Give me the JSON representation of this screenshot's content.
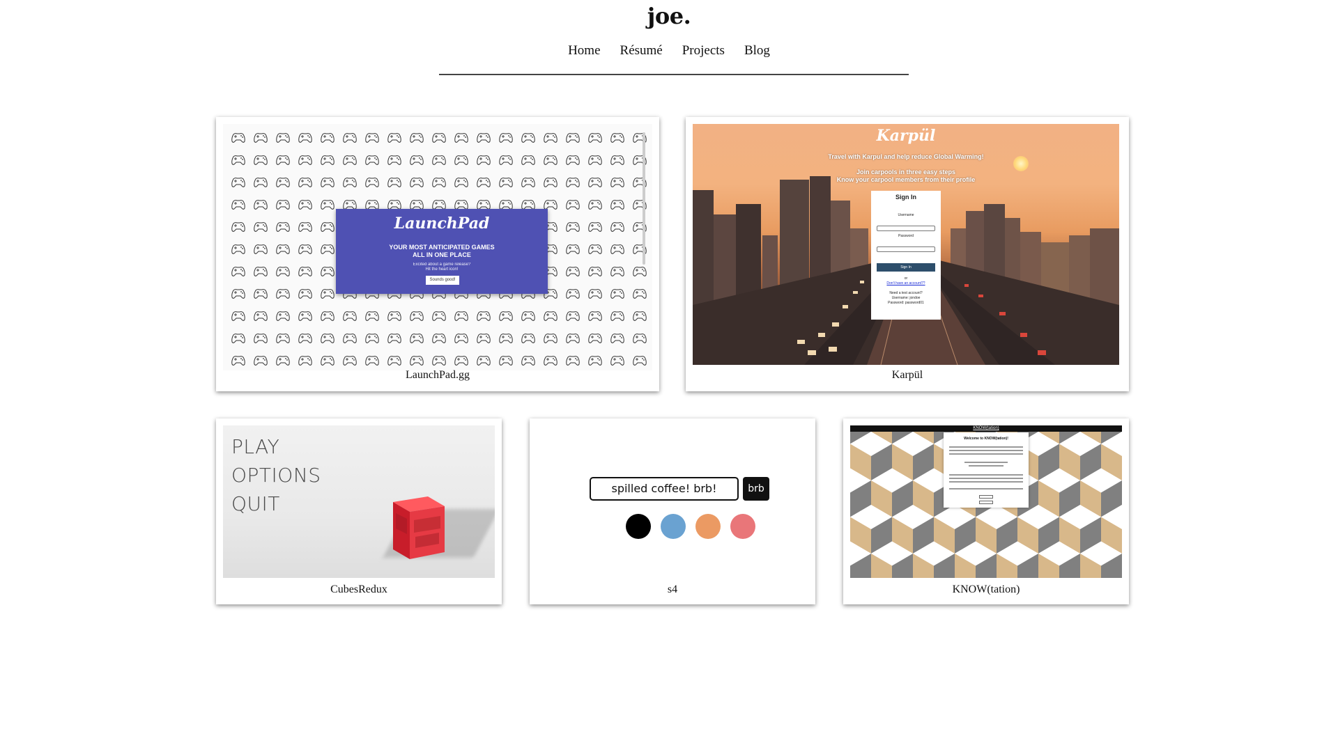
{
  "site": {
    "title": "joe."
  },
  "nav": {
    "items": [
      "Home",
      "Résumé",
      "Projects",
      "Blog"
    ]
  },
  "projects": [
    {
      "caption": "LaunchPad.gg",
      "screenshot": {
        "logo": "LaunchPad",
        "tagline_1": "YOUR MOST ANTICIPATED GAMES",
        "tagline_2": "ALL IN ONE PLACE",
        "sub_1": "Excited about a game release?",
        "sub_2": "Hit the heart icon!",
        "button": "Sounds good!",
        "accent": "#4f51b3",
        "pattern_icon": "gamepad-icon"
      }
    },
    {
      "caption": "Karpül",
      "screenshot": {
        "logo": "Karpül",
        "line_1": "Travel with Karpul and help reduce Global Warming!",
        "line_2": "Join carpools in three easy steps",
        "line_3": "Know your carpool members from their profile",
        "form_title": "Sign In",
        "username_label": "Username",
        "password_label": "Password",
        "signin_button": "Sign In",
        "or": "or",
        "signup_link": "Don't have an account??",
        "test_1": "Need a test account?",
        "test_2": "Username: jondoe",
        "test_3": "Password: password01",
        "button_color": "#2d4e6b"
      }
    },
    {
      "caption": "CubesRedux",
      "screenshot": {
        "menu": [
          "PLAY",
          "OPTIONS",
          "QUIT"
        ],
        "cube_color": "#e8353d"
      }
    },
    {
      "caption": "s4",
      "screenshot": {
        "input_value": "spilled coffee! brb!",
        "button": "brb",
        "swatches": [
          "#000000",
          "#6aa2d1",
          "#eb9a63",
          "#e97679"
        ]
      }
    },
    {
      "caption": "KNOW(tation)",
      "screenshot": {
        "header": "KNOW(tation)",
        "panel_title": "Welcome to KNOW(tation)!",
        "tile_colors": [
          "#ffffff",
          "#d8b88a",
          "#808080"
        ]
      }
    }
  ]
}
